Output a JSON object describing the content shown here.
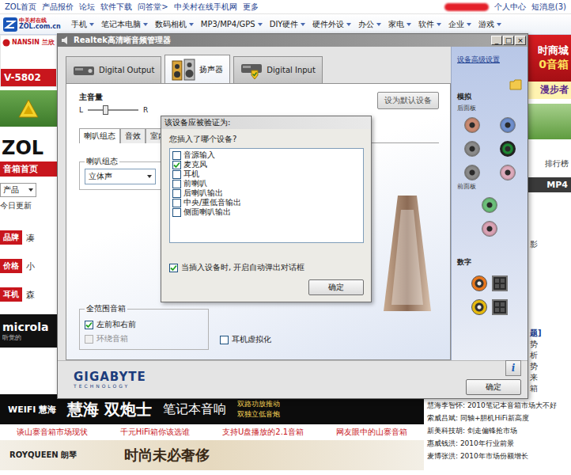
{
  "page": {
    "top_links": [
      "ZOL首页",
      "产品报价",
      "论坛",
      "软件下载",
      "问答堂>",
      "中关村在线手机网",
      "更多"
    ],
    "user_links": [
      "个人中心",
      "短消息(3)"
    ],
    "logo": {
      "name": "中关村在线",
      "domain": "ZOL.com.cn"
    },
    "nav": [
      "手机",
      "笔记本电脑",
      "数码相机",
      "MP3/MP4/GPS",
      "DIY硬件",
      "硬件外设",
      "办公",
      "家电",
      "软件",
      "企业",
      "游戏"
    ],
    "left": {
      "ad_brand": "NANSIN 兰欣",
      "ad_model": "V-5802",
      "site": "ZOL",
      "channel": "音箱首页",
      "select": "产品",
      "today": "今日更新",
      "tags": [
        {
          "label": "品牌",
          "text": "凑"
        },
        {
          "label": "价格",
          "text": "小"
        },
        {
          "label": "耳机",
          "text": "森"
        }
      ],
      "banner": "microla",
      "banner_sub": "听觉的"
    },
    "right": {
      "mall": "时商城",
      "mall_sub": "0音箱",
      "brand": "漫步者",
      "rank": "排行榜",
      "tab": "MP4",
      "topic": "题]",
      "fragments": [
        "影",
        "势",
        "析",
        "势",
        "来",
        "箱"
      ]
    },
    "banner": {
      "brand": "WEIFI 慧海",
      "slogan": "慧海 双炮士",
      "product": "笔记本音响",
      "features": [
        "双路功放推动",
        "双独立低音炮"
      ]
    },
    "links": [
      "谈山寨音箱市场现状",
      "千元HiFi箱你该选谁",
      "支持U盘播放的2.1音箱",
      "网友眼中的山寨音箱"
    ],
    "banner2": {
      "brand": "ROYQUEEN 朗琴",
      "slogan": "时尚未必奢侈"
    },
    "news": [
      "慧海李智怀: 2010笔记本音箱市场大不好",
      "索威吕斌: 同轴+胆机HiFi新高度",
      "新美科技胡: 剑走偏锋抢市场",
      "惠威钱洪: 2010年行业前景",
      "麦博张洪: 2010年市场份额增长"
    ]
  },
  "window": {
    "title": "Realtek高清晰音频管理器",
    "controls": [
      "_",
      "□",
      "×"
    ],
    "tabs": [
      {
        "label": "Digital Output",
        "selected": false
      },
      {
        "label": "扬声器",
        "selected": true
      },
      {
        "label": "Digital Input",
        "selected": false
      }
    ],
    "master_volume": {
      "label": "主音量",
      "left": "L",
      "right": "R",
      "level": 0.35
    },
    "default_button": "设为默认设备",
    "subtabs": [
      {
        "label": "喇叭组态",
        "selected": true
      },
      {
        "label": "音效",
        "selected": false
      },
      {
        "label": "室内校",
        "selected": false
      }
    ],
    "speaker_config": {
      "label": "喇叭组态",
      "value": "立体声"
    },
    "full_range": {
      "label": "全范围音箱",
      "options": [
        {
          "label": "左前和右前",
          "checked": true,
          "disabled": false
        },
        {
          "label": "环绕音箱",
          "checked": false,
          "disabled": true
        }
      ]
    },
    "virtualization": {
      "label": "耳机虚拟化",
      "checked": false
    },
    "side": {
      "advanced": "设备高级设置",
      "analog": "模拟",
      "back_panel": "后面板",
      "back_jacks": [
        {
          "color": "#c98a72",
          "plugged": false
        },
        {
          "color": "#6f8fcc",
          "plugged": false
        },
        {
          "color": "#8a8a8a",
          "plugged": false
        },
        {
          "color": "#1f8a35",
          "plugged": true
        },
        {
          "color": "#8a8a8a",
          "plugged": false
        },
        {
          "color": "#dcaabb",
          "plugged": false
        }
      ],
      "front_panel": "前面板",
      "front_jacks": [
        {
          "color": "#6cbf7a",
          "plugged": false
        },
        {
          "color": "#d9a2b4",
          "plugged": false
        }
      ],
      "digital": "数字",
      "digital_ports": [
        {
          "color": "#e8761c"
        },
        {
          "color": "#e5b90f"
        }
      ]
    },
    "brand": "GIGABYTE",
    "brand_sub": "TECHNOLOGY",
    "info": "i",
    "ok": "确定"
  },
  "dialog": {
    "title": "该设备应被验证为:",
    "question": "您插入了哪个设备?",
    "devices": [
      {
        "label": "音源输入",
        "checked": false
      },
      {
        "label": "麦克风",
        "checked": true
      },
      {
        "label": "耳机",
        "checked": false
      },
      {
        "label": "前喇叭",
        "checked": false
      },
      {
        "label": "后喇叭输出",
        "checked": false
      },
      {
        "label": "中央/重低音输出",
        "checked": false
      },
      {
        "label": "侧面喇叭输出",
        "checked": false
      }
    ],
    "auto_popup": {
      "label": "当插入设备时, 开启自动弹出对话框",
      "checked": true
    },
    "ok": "确定"
  }
}
